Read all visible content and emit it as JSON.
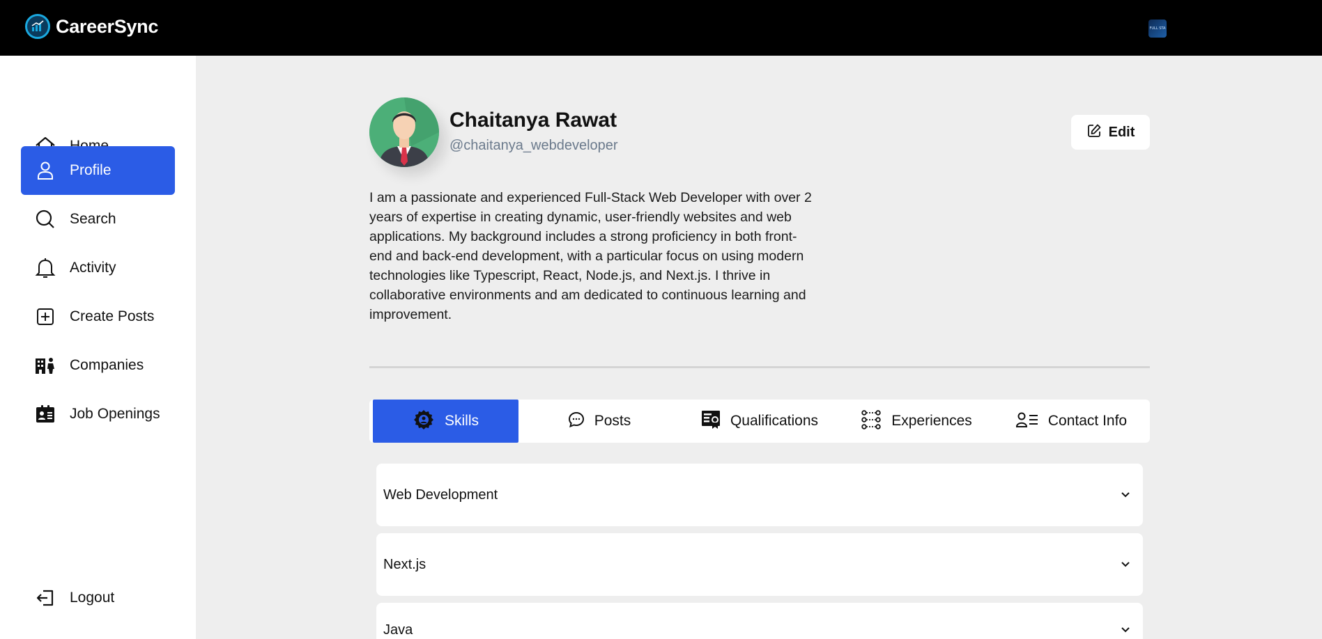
{
  "app": {
    "name": "CareerSync",
    "thumbnail_text": "FULL STA"
  },
  "sidebar": {
    "items": [
      {
        "label": "Home",
        "icon": "home-icon"
      },
      {
        "label": "Profile",
        "icon": "user-icon",
        "active": true
      },
      {
        "label": "Search",
        "icon": "search-icon"
      },
      {
        "label": "Activity",
        "icon": "bell-icon"
      },
      {
        "label": "Create Posts",
        "icon": "plus-square-icon"
      },
      {
        "label": "Companies",
        "icon": "building-icon"
      },
      {
        "label": "Job Openings",
        "icon": "id-card-icon"
      }
    ],
    "logout": {
      "label": "Logout",
      "icon": "logout-icon"
    }
  },
  "profile": {
    "name": "Chaitanya Rawat",
    "handle": "@chaitanya_webdeveloper",
    "edit_label": "Edit",
    "bio": "I am a passionate and experienced Full-Stack Web Developer with over 2 years of expertise in creating dynamic, user-friendly websites and web applications. My background includes a strong proficiency in both front-end and back-end development, with a particular focus on using modern technologies like Typescript, React, Node.js, and Next.js. I thrive in collaborative environments and am dedicated to continuous learning and improvement."
  },
  "tabs": [
    {
      "label": "Skills",
      "icon": "gear-icon",
      "active": true
    },
    {
      "label": "Posts",
      "icon": "chat-bubble-icon"
    },
    {
      "label": "Qualifications",
      "icon": "certificate-icon"
    },
    {
      "label": "Experiences",
      "icon": "route-icon"
    },
    {
      "label": "Contact Info",
      "icon": "contact-icon"
    }
  ],
  "skills": [
    {
      "label": "Web Development"
    },
    {
      "label": "Next.js"
    },
    {
      "label": "Java"
    }
  ],
  "colors": {
    "accent": "#2b5ce6",
    "topbar": "#000000",
    "background": "#eeeeee"
  }
}
